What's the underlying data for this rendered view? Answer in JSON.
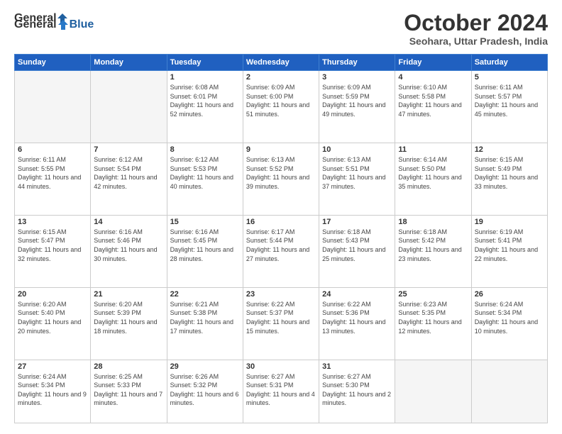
{
  "logo": {
    "general": "General",
    "blue": "Blue"
  },
  "title": "October 2024",
  "location": "Seohara, Uttar Pradesh, India",
  "days_header": [
    "Sunday",
    "Monday",
    "Tuesday",
    "Wednesday",
    "Thursday",
    "Friday",
    "Saturday"
  ],
  "weeks": [
    [
      {
        "day": "",
        "info": ""
      },
      {
        "day": "",
        "info": ""
      },
      {
        "day": "1",
        "info": "Sunrise: 6:08 AM\nSunset: 6:01 PM\nDaylight: 11 hours and 52 minutes."
      },
      {
        "day": "2",
        "info": "Sunrise: 6:09 AM\nSunset: 6:00 PM\nDaylight: 11 hours and 51 minutes."
      },
      {
        "day": "3",
        "info": "Sunrise: 6:09 AM\nSunset: 5:59 PM\nDaylight: 11 hours and 49 minutes."
      },
      {
        "day": "4",
        "info": "Sunrise: 6:10 AM\nSunset: 5:58 PM\nDaylight: 11 hours and 47 minutes."
      },
      {
        "day": "5",
        "info": "Sunrise: 6:11 AM\nSunset: 5:57 PM\nDaylight: 11 hours and 45 minutes."
      }
    ],
    [
      {
        "day": "6",
        "info": "Sunrise: 6:11 AM\nSunset: 5:55 PM\nDaylight: 11 hours and 44 minutes."
      },
      {
        "day": "7",
        "info": "Sunrise: 6:12 AM\nSunset: 5:54 PM\nDaylight: 11 hours and 42 minutes."
      },
      {
        "day": "8",
        "info": "Sunrise: 6:12 AM\nSunset: 5:53 PM\nDaylight: 11 hours and 40 minutes."
      },
      {
        "day": "9",
        "info": "Sunrise: 6:13 AM\nSunset: 5:52 PM\nDaylight: 11 hours and 39 minutes."
      },
      {
        "day": "10",
        "info": "Sunrise: 6:13 AM\nSunset: 5:51 PM\nDaylight: 11 hours and 37 minutes."
      },
      {
        "day": "11",
        "info": "Sunrise: 6:14 AM\nSunset: 5:50 PM\nDaylight: 11 hours and 35 minutes."
      },
      {
        "day": "12",
        "info": "Sunrise: 6:15 AM\nSunset: 5:49 PM\nDaylight: 11 hours and 33 minutes."
      }
    ],
    [
      {
        "day": "13",
        "info": "Sunrise: 6:15 AM\nSunset: 5:47 PM\nDaylight: 11 hours and 32 minutes."
      },
      {
        "day": "14",
        "info": "Sunrise: 6:16 AM\nSunset: 5:46 PM\nDaylight: 11 hours and 30 minutes."
      },
      {
        "day": "15",
        "info": "Sunrise: 6:16 AM\nSunset: 5:45 PM\nDaylight: 11 hours and 28 minutes."
      },
      {
        "day": "16",
        "info": "Sunrise: 6:17 AM\nSunset: 5:44 PM\nDaylight: 11 hours and 27 minutes."
      },
      {
        "day": "17",
        "info": "Sunrise: 6:18 AM\nSunset: 5:43 PM\nDaylight: 11 hours and 25 minutes."
      },
      {
        "day": "18",
        "info": "Sunrise: 6:18 AM\nSunset: 5:42 PM\nDaylight: 11 hours and 23 minutes."
      },
      {
        "day": "19",
        "info": "Sunrise: 6:19 AM\nSunset: 5:41 PM\nDaylight: 11 hours and 22 minutes."
      }
    ],
    [
      {
        "day": "20",
        "info": "Sunrise: 6:20 AM\nSunset: 5:40 PM\nDaylight: 11 hours and 20 minutes."
      },
      {
        "day": "21",
        "info": "Sunrise: 6:20 AM\nSunset: 5:39 PM\nDaylight: 11 hours and 18 minutes."
      },
      {
        "day": "22",
        "info": "Sunrise: 6:21 AM\nSunset: 5:38 PM\nDaylight: 11 hours and 17 minutes."
      },
      {
        "day": "23",
        "info": "Sunrise: 6:22 AM\nSunset: 5:37 PM\nDaylight: 11 hours and 15 minutes."
      },
      {
        "day": "24",
        "info": "Sunrise: 6:22 AM\nSunset: 5:36 PM\nDaylight: 11 hours and 13 minutes."
      },
      {
        "day": "25",
        "info": "Sunrise: 6:23 AM\nSunset: 5:35 PM\nDaylight: 11 hours and 12 minutes."
      },
      {
        "day": "26",
        "info": "Sunrise: 6:24 AM\nSunset: 5:34 PM\nDaylight: 11 hours and 10 minutes."
      }
    ],
    [
      {
        "day": "27",
        "info": "Sunrise: 6:24 AM\nSunset: 5:34 PM\nDaylight: 11 hours and 9 minutes."
      },
      {
        "day": "28",
        "info": "Sunrise: 6:25 AM\nSunset: 5:33 PM\nDaylight: 11 hours and 7 minutes."
      },
      {
        "day": "29",
        "info": "Sunrise: 6:26 AM\nSunset: 5:32 PM\nDaylight: 11 hours and 6 minutes."
      },
      {
        "day": "30",
        "info": "Sunrise: 6:27 AM\nSunset: 5:31 PM\nDaylight: 11 hours and 4 minutes."
      },
      {
        "day": "31",
        "info": "Sunrise: 6:27 AM\nSunset: 5:30 PM\nDaylight: 11 hours and 2 minutes."
      },
      {
        "day": "",
        "info": ""
      },
      {
        "day": "",
        "info": ""
      }
    ]
  ]
}
